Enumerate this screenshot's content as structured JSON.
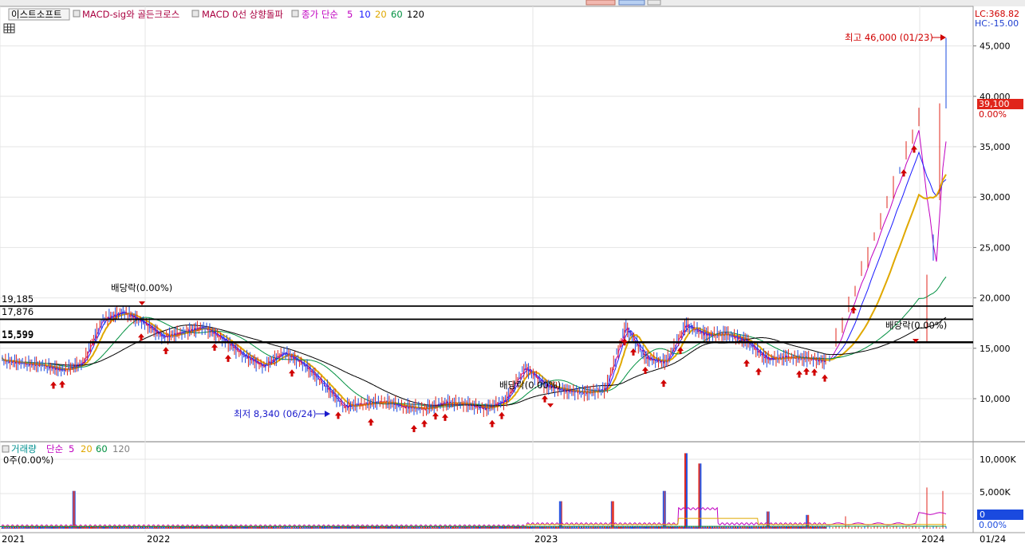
{
  "toolbar": {
    "stock_name": "이스트소프트",
    "items": [
      {
        "label": "MACD-sig와 골든크로스",
        "color": "#aa0040"
      },
      {
        "label": "MACD 0선 상향돌파",
        "color": "#aa0040"
      },
      {
        "label": "종가 단순",
        "color": "#c000c0"
      }
    ],
    "ma_periods": [
      {
        "label": "5",
        "color": "#c000c0"
      },
      {
        "label": "10",
        "color": "#1a1aff"
      },
      {
        "label": "20",
        "color": "#e0a800"
      },
      {
        "label": "60",
        "color": "#009040"
      },
      {
        "label": "120",
        "color": "#000000"
      }
    ]
  },
  "corner": {
    "lc": "LC:368.82",
    "hc": "HC:-15.00"
  },
  "price_panel": {
    "annotations": {
      "high": "최고 46,000 (01/23)",
      "low": "최저 8,340 (06/24)",
      "dividend_1": "배당락(0.00%)",
      "dividend_2": "배당락(0.00%)",
      "dividend_3": "배당락(0.00%)"
    },
    "levels": [
      {
        "label": "19,185",
        "value": 19185
      },
      {
        "label": "17,876",
        "value": 17876
      },
      {
        "label": "15,599",
        "value": 15599
      },
      {
        "label": "15,599",
        "value": 15599
      }
    ],
    "last_price": "39,100",
    "last_change": "0.00%",
    "y_ticks": [
      "10,000",
      "15,000",
      "20,000",
      "25,000",
      "30,000",
      "35,000",
      "40,000",
      "45,000"
    ]
  },
  "volume_panel": {
    "legend_title": "거래량",
    "legend_ma": "단순",
    "legend_periods": [
      {
        "label": "5",
        "color": "#c000c0"
      },
      {
        "label": "20",
        "color": "#e0a800"
      },
      {
        "label": "60",
        "color": "#009040"
      },
      {
        "label": "120",
        "color": "#808080"
      }
    ],
    "info": "0주(0.00%)",
    "last_volume": "0",
    "last_change": "0.00%",
    "y_ticks": [
      "5,000K",
      "10,000K"
    ]
  },
  "x_axis": {
    "labels": [
      "2021",
      "2022",
      "2023",
      "2024",
      "01/24"
    ]
  },
  "chart_data": {
    "type": "line",
    "title": "이스트소프트",
    "x": [
      "2021-01",
      "2021-02",
      "2021-03",
      "2021-04",
      "2021-05",
      "2021-06",
      "2021-07",
      "2021-08",
      "2021-09",
      "2021-10",
      "2021-11",
      "2021-12",
      "2022-01",
      "2022-02",
      "2022-03",
      "2022-04",
      "2022-05",
      "2022-06",
      "2022-07",
      "2022-08",
      "2022-09",
      "2022-10",
      "2022-11",
      "2022-12",
      "2023-01",
      "2023-02",
      "2023-03",
      "2023-04",
      "2023-05",
      "2023-06",
      "2023-07",
      "2023-08",
      "2023-09",
      "2023-10",
      "2023-11",
      "2023-12",
      "2024-01"
    ],
    "series": [
      {
        "name": "종가",
        "values": [
          13800,
          13500,
          13300,
          12800,
          13500,
          17800,
          18600,
          17600,
          16100,
          16600,
          17100,
          15900,
          14300,
          13200,
          14600,
          13400,
          11400,
          9200,
          9500,
          9700,
          9200,
          9000,
          9600,
          9500,
          9000,
          9800,
          13100,
          11300,
          10800,
          10600,
          10900,
          17100,
          14000,
          13600,
          17300,
          16300,
          16400,
          15700,
          13900,
          14100,
          14000,
          13700,
          39100
        ]
      }
    ],
    "x_tick_labels": [
      "2021",
      "2022",
      "2023",
      "2024",
      "01/24"
    ],
    "y_tick_labels": [
      "10,000",
      "15,000",
      "20,000",
      "25,000",
      "30,000",
      "35,000",
      "40,000",
      "45,000"
    ],
    "ylim": [
      5000,
      47000
    ],
    "horizontal_lines": [
      19185,
      17876,
      15599
    ],
    "high": 46000,
    "low": 8340,
    "last": 39100,
    "volume": {
      "y_tick_labels": [
        "5,000K",
        "10,000K"
      ],
      "ylim": [
        0,
        13000
      ]
    }
  }
}
